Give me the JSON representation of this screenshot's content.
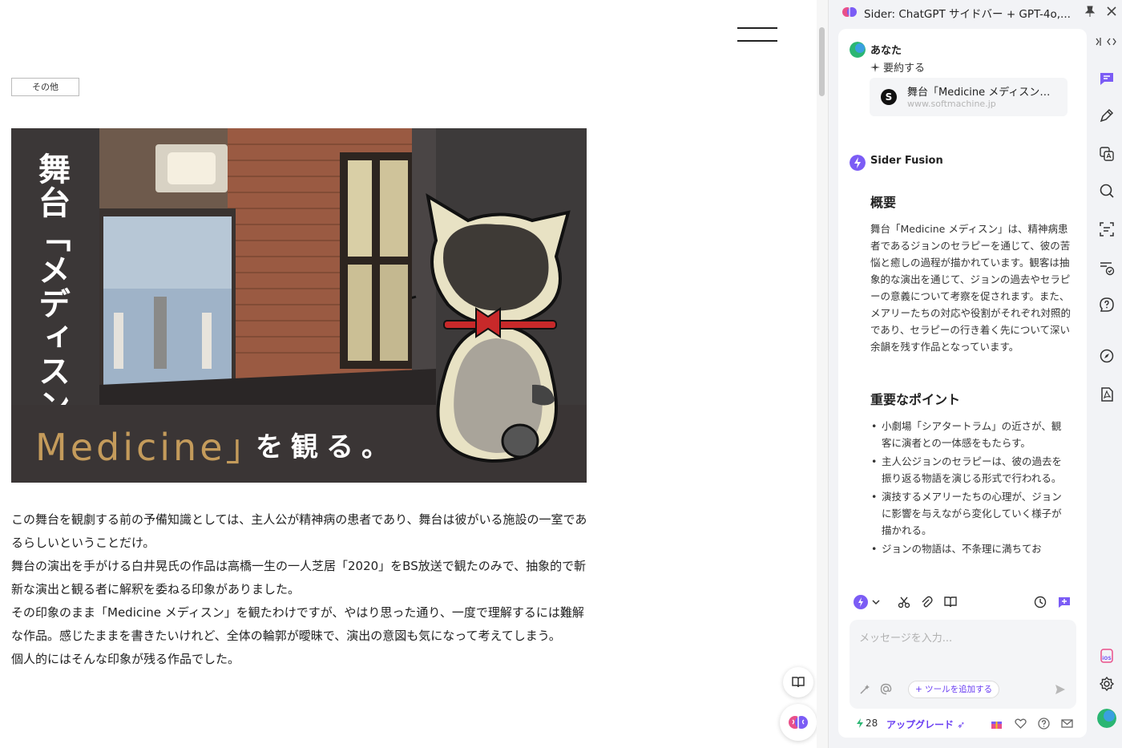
{
  "page": {
    "category_tag": "その他",
    "hero": {
      "vertical_title": "舞台「メディスン",
      "en_title": "Medicine」",
      "jp_suffix": "を観る。"
    },
    "article": [
      "この舞台を観劇する前の予備知識としては、主人公が精神病の患者であり、舞台は彼がいる施設の一室であるらしいということだけ。",
      "舞台の演出を手がける白井晃氏の作品は高橋一生の一人芝居「2020」をBS放送で観たのみで、抽象的で斬新な演出と観る者に解釈を委ねる印象がありました。",
      "その印象のまま「Medicine メディスン」を観たわけですが、やはり思った通り、一度で理解するには難解な作品。感じたままを書きたいけれど、全体の輪郭が曖昧で、演出の意図も気になって考えてしまう。",
      "個人的にはそんな印象が残る作品でした。"
    ]
  },
  "sider": {
    "title": "Sider: ChatGPT サイドバー + GPT-4o,...",
    "user": {
      "name": "あなた",
      "action": "要約する",
      "page_card": {
        "title": "舞台「Medicine メディスン」を観る。",
        "url": "www.softmachine.jp"
      }
    },
    "bot": {
      "name": "Sider Fusion",
      "overview_heading": "概要",
      "overview_text": "舞台「Medicine メディスン」は、精神病患者であるジョンのセラピーを通じて、彼の苦悩と癒しの過程が描かれています。観客は抽象的な演出を通じて、ジョンの過去やセラピーの意義について考察を促されます。また、メアリーたちの対応や役割がそれぞれ対照的であり、セラピーの行き着く先について深い余韻を残す作品となっています。",
      "points_heading": "重要なポイント",
      "points": [
        "小劇場「シアタートラム」の近さが、観客に演者との一体感をもたらす。",
        "主人公ジョンのセラピーは、彼の過去を振り返る物語を演じる形式で行われる。",
        "演技するメアリーたちの心理が、ジョンに影響を与えながら変化していく様子が描かれる。",
        "ジョンの物語は、不条理に満ちてお"
      ]
    },
    "input": {
      "placeholder": "メッセージを入力...",
      "add_tool": "+ ツールを追加する"
    },
    "footer": {
      "credits": "28",
      "upgrade": "アップグレード"
    },
    "colors": {
      "accent": "#6a3ef2",
      "panel_bg": "#f2f3f6"
    }
  }
}
